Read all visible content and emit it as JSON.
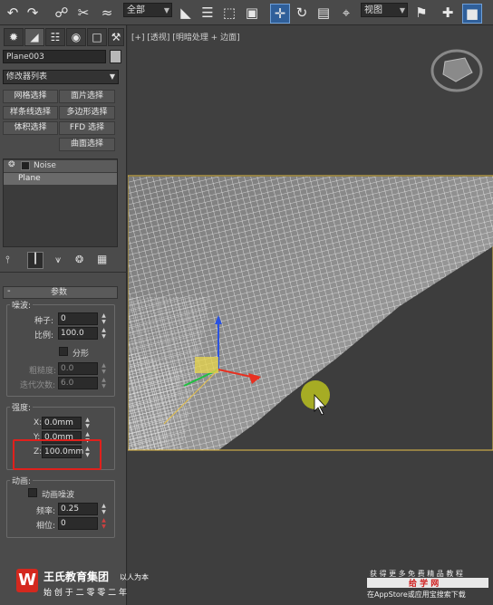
{
  "toolbar": {
    "selection_filter": "全部",
    "ref_coord": "视图",
    "icons": [
      "undo-icon",
      "redo-icon",
      "link-icon",
      "unlink-icon",
      "bind-space-warp-icon",
      "select-object-icon",
      "select-by-name-icon",
      "rect-region-icon",
      "window-crossing-icon",
      "move-icon",
      "rotate-icon",
      "scale-icon",
      "select-manipulate-icon",
      "named-selection-icon",
      "mirror-icon",
      "align-icon",
      "layer-manager-icon"
    ]
  },
  "panel": {
    "object_name": "Plane003",
    "modifier_list": "修改器列表",
    "buttons": [
      [
        "网格选择",
        "面片选择"
      ],
      [
        "样条线选择",
        "多边形选择"
      ],
      [
        "体积选择",
        "FFD 选择"
      ],
      [
        "",
        "曲面选择"
      ]
    ],
    "stack": {
      "modifier": "Noise",
      "base": "Plane"
    },
    "rollout_title": "参数",
    "noise": {
      "title": "噪波:",
      "seed_label": "种子:",
      "seed_value": "0",
      "scale_label": "比例:",
      "scale_value": "100.0",
      "fractal_label": "分形",
      "roughness_label": "粗糙度:",
      "roughness_value": "0.0",
      "iterations_label": "迭代次数:",
      "iterations_value": "6.0"
    },
    "strength": {
      "title": "强度:",
      "x_label": "X:",
      "x_value": "0.0mm",
      "y_label": "Y:",
      "y_value": "0.0mm",
      "z_label": "Z:",
      "z_value": "100.0mm"
    },
    "animation": {
      "title": "动画:",
      "animate_label": "动画噪波",
      "freq_label": "频率:",
      "freq_value": "0.25",
      "phase_label": "相位:",
      "phase_value": "0"
    }
  },
  "viewport": {
    "label": "[+] [透视] [明暗处理 + 边面]"
  },
  "watermark": {
    "left_title": "王氏教育集团",
    "left_tag": "以人为本",
    "left_sub": "始 创 于 二 零 零 二 年",
    "right_line1": "获 得 更 多 免 费 精 品 教 程",
    "right_brand": "给 学 网",
    "right_line2": "在AppStore或应用宝搜索下载"
  },
  "colors": {
    "highlight_box": "#e0201c",
    "selection_edge": "#e8c24a",
    "mesh_wire": "#f2f2f2",
    "cursor_highlight": "#b8c020"
  }
}
